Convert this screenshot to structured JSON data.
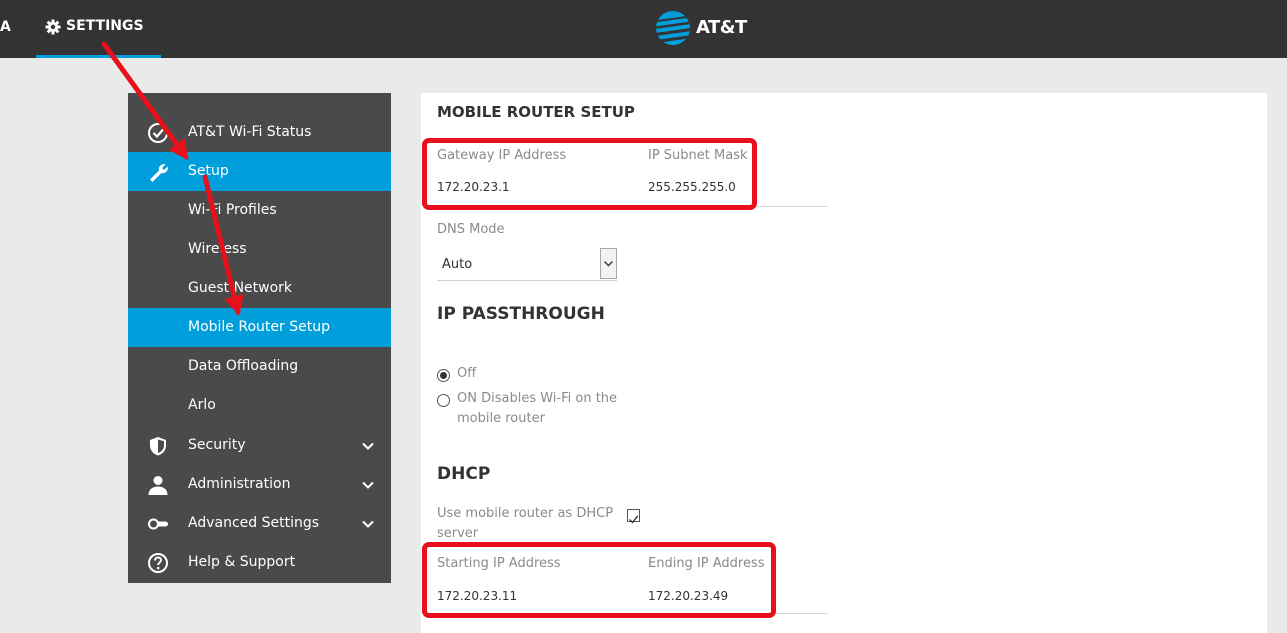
{
  "topbar": {
    "partial_tab": "A",
    "settings_tab": "SETTINGS",
    "logo_text": "AT&T"
  },
  "sidebar": {
    "items": [
      {
        "label": "AT&T Wi-Fi Status",
        "icon": "check-circle-icon"
      },
      {
        "label": "Setup",
        "icon": "wrench-icon",
        "active": true
      },
      {
        "label": "Wi-Fi Profiles"
      },
      {
        "label": "Wireless"
      },
      {
        "label": "Guest Network"
      },
      {
        "label": "Mobile Router Setup",
        "active": true
      },
      {
        "label": "Data Offloading"
      },
      {
        "label": "Arlo"
      },
      {
        "label": "Security",
        "icon": "shield-icon",
        "expandable": true
      },
      {
        "label": "Administration",
        "icon": "user-icon",
        "expandable": true
      },
      {
        "label": "Advanced Settings",
        "icon": "toggle-icon",
        "expandable": true
      },
      {
        "label": "Help & Support",
        "icon": "question-circle-icon"
      }
    ]
  },
  "main": {
    "router_setup": {
      "title": "MOBILE ROUTER SETUP",
      "gateway_label": "Gateway IP Address",
      "gateway_value": "172.20.23.1",
      "subnet_label": "IP Subnet Mask",
      "subnet_value": "255.255.255.0",
      "dns_label": "DNS Mode",
      "dns_value": "Auto"
    },
    "passthrough": {
      "title": "IP PASSTHROUGH",
      "option_off": "Off",
      "option_on_line1": "ON Disables Wi-Fi on the",
      "option_on_line2": "mobile router",
      "selected": "Off"
    },
    "dhcp": {
      "title": "DHCP",
      "use_label_line1": "Use mobile router as DHCP",
      "use_label_line2": "server",
      "use_checked": true,
      "start_label": "Starting IP Address",
      "start_value": "172.20.23.11",
      "end_label": "Ending IP Address",
      "end_value": "172.20.23.49"
    }
  },
  "colors": {
    "topbar": "#333333",
    "accent": "#009fdb",
    "sidebar": "#4a4a4a",
    "annotation": "#e8101b"
  }
}
